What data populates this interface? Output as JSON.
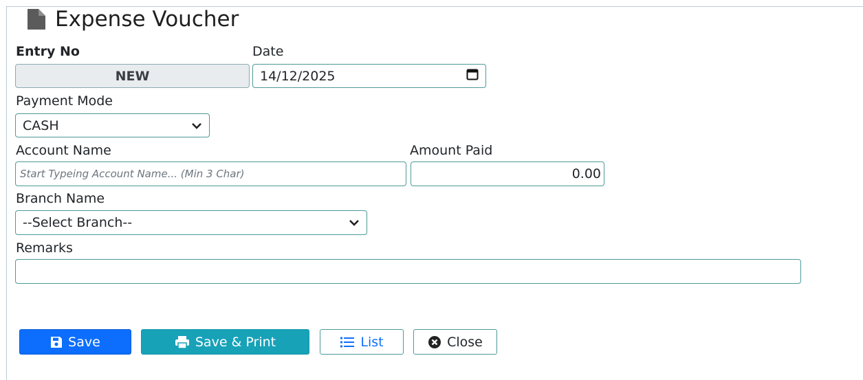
{
  "page": {
    "title": "Expense Voucher",
    "title_icon": "file-icon"
  },
  "form": {
    "entry_no_label": "Entry No",
    "entry_no_value": "NEW",
    "date_label": "Date",
    "date_value": "14/12/2025",
    "payment_mode_label": "Payment Mode",
    "payment_mode_value": "CASH",
    "account_name_label": "Account Name",
    "account_name_placeholder": "Start Typeing Account Name... (Min 3 Char)",
    "amount_paid_label": "Amount Paid",
    "amount_paid_value": "0.00",
    "branch_name_label": "Branch Name",
    "branch_value": "--Select Branch--",
    "remarks_label": "Remarks",
    "remarks_value": ""
  },
  "actions": {
    "save_label": "Save",
    "save_print_label": "Save & Print",
    "list_label": "List",
    "close_label": "Close"
  },
  "colors": {
    "primary": "#0d6efd",
    "info": "#17a2b8",
    "border_accent": "#4a9a98",
    "readonly_bg": "#e9ecef"
  }
}
